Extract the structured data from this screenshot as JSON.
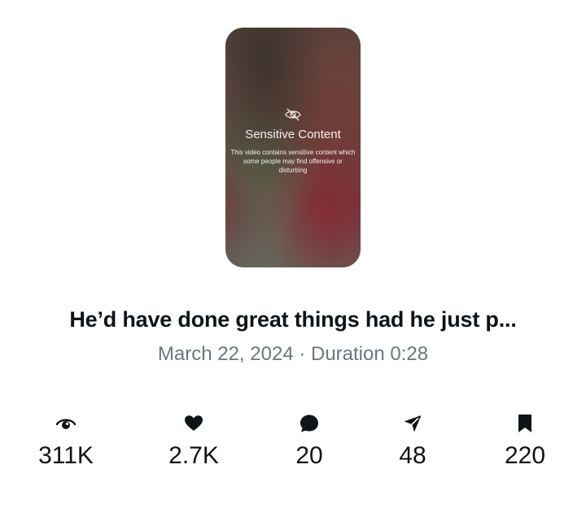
{
  "thumbnail": {
    "warning_icon": "eye-slash-icon",
    "warning_title": "Sensitive Content",
    "warning_desc": "This video contains sensitive content which some people may find offensive or disturbing"
  },
  "post": {
    "title": "He’d have done great things had he just p...",
    "meta": "March 22, 2024 · Duration 0:28"
  },
  "stats": [
    {
      "icon": "views-icon",
      "value": "311K"
    },
    {
      "icon": "heart-icon",
      "value": "2.7K"
    },
    {
      "icon": "reply-icon",
      "value": "20"
    },
    {
      "icon": "share-icon",
      "value": "48"
    },
    {
      "icon": "bookmark-icon",
      "value": "220"
    }
  ],
  "colors": {
    "text": "#0f1419",
    "secondary": "#6b7680",
    "background": "#ffffff"
  }
}
